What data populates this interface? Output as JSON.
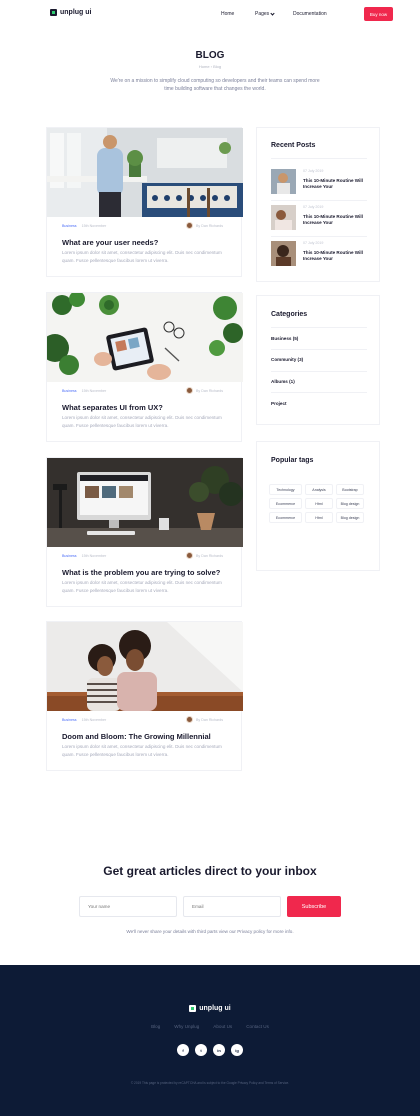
{
  "header": {
    "logo": "unplug ui",
    "nav": [
      "Home",
      "Pages",
      "Documentation"
    ],
    "cta": "Buy now"
  },
  "hero": {
    "title": "BLOG",
    "breadcrumb": "Home › Blog",
    "description": "We're on a mission to simplify cloud computing so developers and their teams can spend more time building software that changes the world."
  },
  "posts": [
    {
      "category": "Business",
      "date": "15th November",
      "author": "By Dan Richards",
      "title": "What are your user needs?",
      "excerpt": "Lorem ipsum dolor sit amet, consectetur adipiscing elit. Duis nec condimentum quam. Fusce pellentesque faucibus lorem ut viverra."
    },
    {
      "category": "Business",
      "date": "15th November",
      "author": "By Dan Richards",
      "title": "What separates UI from UX?",
      "excerpt": "Lorem ipsum dolor sit amet, consectetur adipiscing elit. Duis nec condimentum quam. Fusce pellentesque faucibus lorem ut viverra."
    },
    {
      "category": "Business",
      "date": "15th November",
      "author": "By Dan Richards",
      "title": "What is the problem you are trying to solve?",
      "excerpt": "Lorem ipsum dolor sit amet, consectetur adipiscing elit. Duis nec condimentum quam. Fusce pellentesque faucibus lorem ut viverra."
    },
    {
      "category": "Business",
      "date": "15th November",
      "author": "By Dan Richards",
      "title": "Doom and Bloom: The Growing Millennial",
      "excerpt": "Lorem ipsum dolor sit amet, consectetur adipiscing elit. Duis nec condimentum quam. Fusce pellentesque faucibus lorem ut viverra."
    }
  ],
  "sidebar": {
    "recent_title": "Recent Posts",
    "recent": [
      {
        "date": "07 July 2019",
        "title": "This 10-Minute Routine Will Increase Your"
      },
      {
        "date": "07 July 2019",
        "title": "This 10-Minute Routine Will Increase Your"
      },
      {
        "date": "07 July 2019",
        "title": "This 10-Minute Routine Will Increase Your"
      }
    ],
    "categories_title": "Categories",
    "categories": [
      "Business (5)",
      "Community (3)",
      "Albums (1)",
      "Project"
    ],
    "tags_title": "Popular tags",
    "tags": [
      "Technology",
      "Analysis",
      "Bootstrap",
      "Ecommerce",
      "Html",
      "Blog design",
      "Ecommerce",
      "Html",
      "Blog design"
    ]
  },
  "newsletter": {
    "title": "Get great articles direct to your inbox",
    "name_placeholder": "Your name",
    "email_placeholder": "Email",
    "button": "Subscribe",
    "note": "We'll never share your details with third parts view our Privacy policy for more info."
  },
  "footer": {
    "logo": "unplug ui",
    "links": [
      "Blog",
      "Why Unplug",
      "About Us",
      "Contact Us"
    ],
    "social": [
      "f",
      "t",
      "in",
      "ig"
    ],
    "copyright": "© 2019 This page is protected by reCAPTCHA and is subject to the Google Privacy Policy and Terms of Service."
  },
  "colors": {
    "accent": "#f0284d",
    "link": "#4a6cf7",
    "footer_bg": "#0d1b36",
    "text": "#1a1a2e"
  }
}
